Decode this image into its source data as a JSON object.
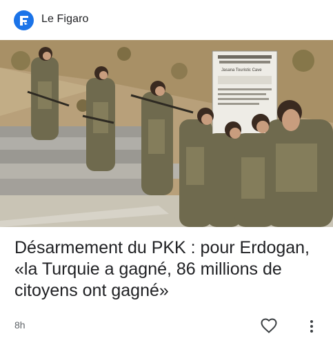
{
  "source": {
    "name": "Le Figaro",
    "logo_icon": "le-figaro-logo-icon",
    "accent": "#1a73e8"
  },
  "article": {
    "headline": "Désarmement du PKK : pour Erdogan, «la Turquie a gagné, 86 millions de citoyens ont gagné»",
    "age": "8h"
  },
  "image": {
    "description_icon": "news-photo",
    "sign_text": "Jasana Touristic Cave"
  },
  "actions": {
    "like_icon": "heart-icon",
    "more_icon": "more-vert-icon"
  }
}
